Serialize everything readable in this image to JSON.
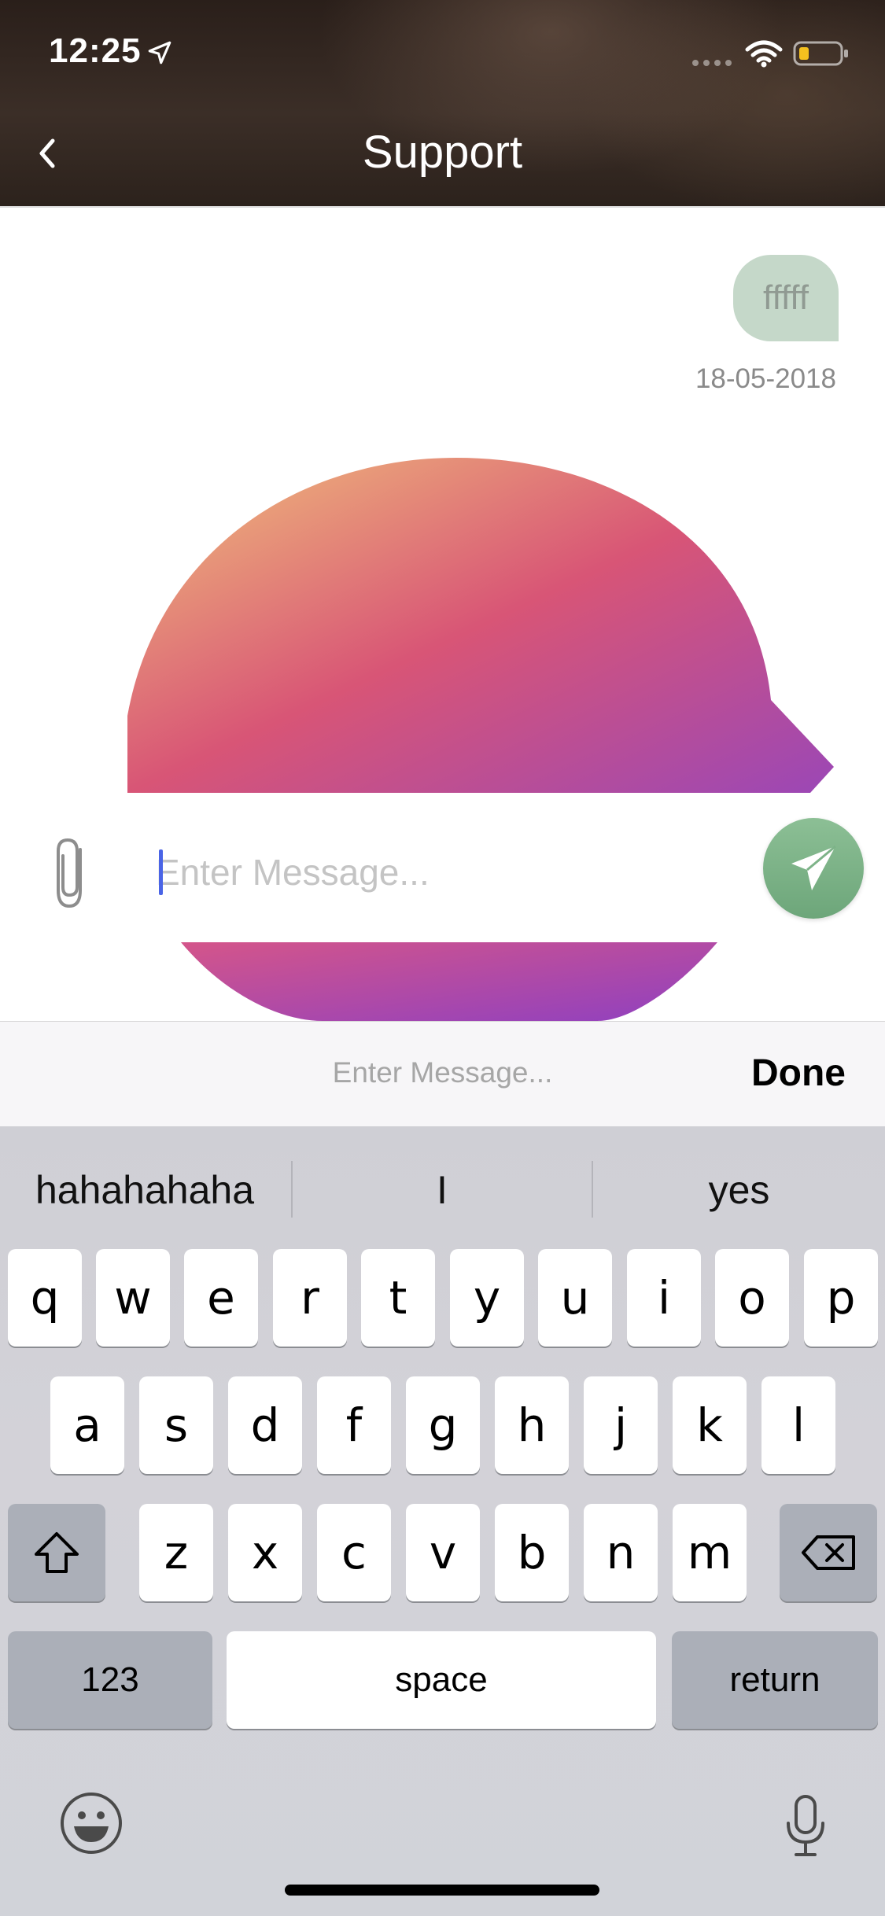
{
  "status_bar": {
    "time": "12:25"
  },
  "header": {
    "title": "Support",
    "back_icon": "chevron-left-icon"
  },
  "chat": {
    "messages": [
      {
        "text": "fffff",
        "date": "18-05-2018",
        "bubble_color": "#c5d8c9"
      }
    ],
    "image_colors": [
      "#f1c27b",
      "#d85576",
      "#9b47b6"
    ]
  },
  "composer": {
    "placeholder": "Enter Message...",
    "value": "",
    "attach_icon": "paperclip-icon",
    "send_icon": "paper-plane-icon",
    "send_color": "#7db388"
  },
  "keyboard_accessory": {
    "placeholder": "Enter Message...",
    "done_label": "Done"
  },
  "keyboard": {
    "suggestions": [
      "hahahahaha",
      "I",
      "yes"
    ],
    "row1": [
      "q",
      "w",
      "e",
      "r",
      "t",
      "y",
      "u",
      "i",
      "o",
      "p"
    ],
    "row2": [
      "a",
      "s",
      "d",
      "f",
      "g",
      "h",
      "j",
      "k",
      "l"
    ],
    "row3": [
      "z",
      "x",
      "c",
      "v",
      "b",
      "n",
      "m"
    ],
    "numbers_label": "123",
    "space_label": "space",
    "return_label": "return"
  }
}
